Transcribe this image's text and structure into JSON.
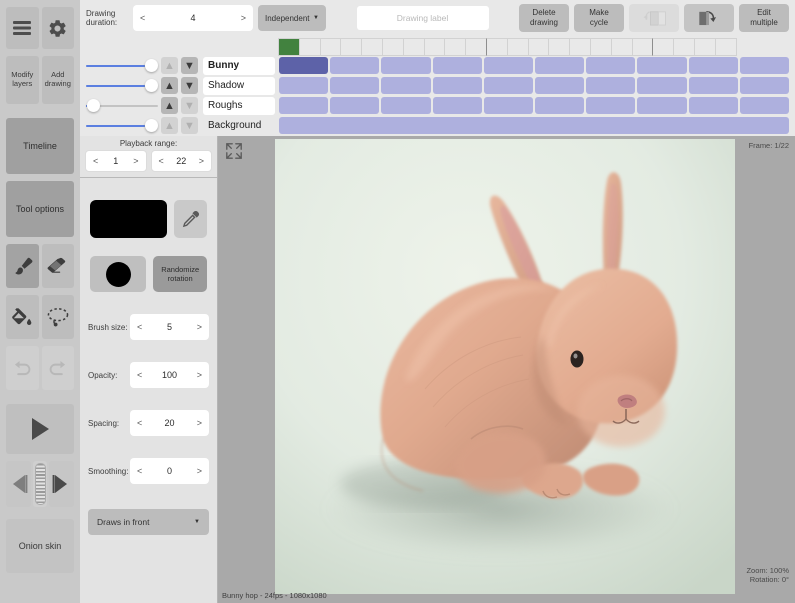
{
  "sidebar": {
    "menu_icon": "hamburger-icon",
    "settings_icon": "gear-icon",
    "modify_layers": "Modify\nlayers",
    "modify_layers_label": "Modify layers",
    "add_drawing_label": "Add drawing",
    "timeline_tab": "Timeline",
    "tool_options_tab": "Tool options",
    "tools": [
      {
        "name": "brush-icon",
        "label": "Brush",
        "active": true
      },
      {
        "name": "eraser-icon",
        "label": "Eraser",
        "active": false
      },
      {
        "name": "fill-bucket-icon",
        "label": "Fill",
        "active": false
      },
      {
        "name": "lasso-select-icon",
        "label": "Lasso",
        "active": false
      },
      {
        "name": "undo-icon",
        "label": "Undo",
        "active": false
      },
      {
        "name": "redo-icon",
        "label": "Redo",
        "active": false
      }
    ],
    "play_label": "Play",
    "prev_frame_label": "Previous frame",
    "next_frame_label": "Next frame",
    "onion_skin": "Onion skin"
  },
  "topbar": {
    "duration_label_line1": "Drawing",
    "duration_label_line2": "duration:",
    "duration_value": "4",
    "arrow_left": "<",
    "arrow_right": ">",
    "mode_dropdown": "Independent",
    "dropdown_caret": "▼",
    "drawing_label_placeholder": "Drawing label",
    "drawing_label_value": "",
    "delete_drawing": "Delete\ndrawing",
    "delete_drawing_l1": "Delete",
    "delete_drawing_l2": "drawing",
    "make_cycle_l1": "Make",
    "make_cycle_l2": "cycle",
    "flip_back_icon": "flip-pages-back-icon",
    "flip_fwd_icon": "flip-pages-forward-icon",
    "edit_multiple_l1": "Edit",
    "edit_multiple_l2": "multiple"
  },
  "timeline": {
    "total_cells": 22,
    "playhead_cell": 0,
    "major_ticks": [
      9,
      17
    ],
    "layers": [
      {
        "name": "Bunny",
        "opacity": 100,
        "up_enabled": false,
        "down_enabled": true,
        "selected_cell": 0,
        "cells": 10,
        "continuous": false,
        "selected": true
      },
      {
        "name": "Shadow",
        "opacity": 100,
        "up_enabled": true,
        "down_enabled": true,
        "selected_cell": -1,
        "cells": 10,
        "continuous": false,
        "selected": false
      },
      {
        "name": "Roughs",
        "opacity": 2,
        "up_enabled": true,
        "down_enabled": false,
        "selected_cell": -1,
        "cells": 10,
        "continuous": false,
        "selected": false
      },
      {
        "name": "Background",
        "opacity": 100,
        "up_enabled": false,
        "down_enabled": false,
        "selected_cell": -1,
        "cells": 1,
        "continuous": true,
        "selected": false
      }
    ],
    "arrow_up": "▲",
    "arrow_down": "▼"
  },
  "toolpanel": {
    "playback_range_title": "Playback range:",
    "playback_start": "1",
    "playback_end": "22",
    "arrow_left": "<",
    "arrow_right": ">",
    "color_swatch": "#000000",
    "eyedropper_icon": "eyedropper-icon",
    "brush_preview_icon": "brush-tip-dot-icon",
    "randomize_rotation_l1": "Randomize",
    "randomize_rotation_l2": "rotation",
    "brush_size_label": "Brush size:",
    "brush_size_value": "5",
    "opacity_label": "Opacity:",
    "opacity_value": "100",
    "spacing_label": "Spacing:",
    "spacing_value": "20",
    "smoothing_label": "Smoothing:",
    "smoothing_value": "0",
    "draw_order": "Draws in front",
    "dropdown_caret": "▼"
  },
  "canvas": {
    "expand_icon": "expand-canvas-icon",
    "frame_label": "Frame: 1/22",
    "zoom_label": "Zoom: 100%",
    "rotation_label": "Rotation: 0°",
    "project_label": "Bunny hop - 24fps - 1080x1080",
    "artwork_description": "Digital painting of a tan rabbit sitting on a pale mint-green background",
    "background_color": "#e4ece2",
    "rabbit_color": "#e0ac92"
  },
  "colors": {
    "panel_bg": "#e8e8e8",
    "sidebar_bg": "#c9c9c9",
    "cell_normal": "#aeb0de",
    "cell_selected": "#5d62a8",
    "playhead_green": "#42823f",
    "slider_blue": "#5b7fe0"
  }
}
